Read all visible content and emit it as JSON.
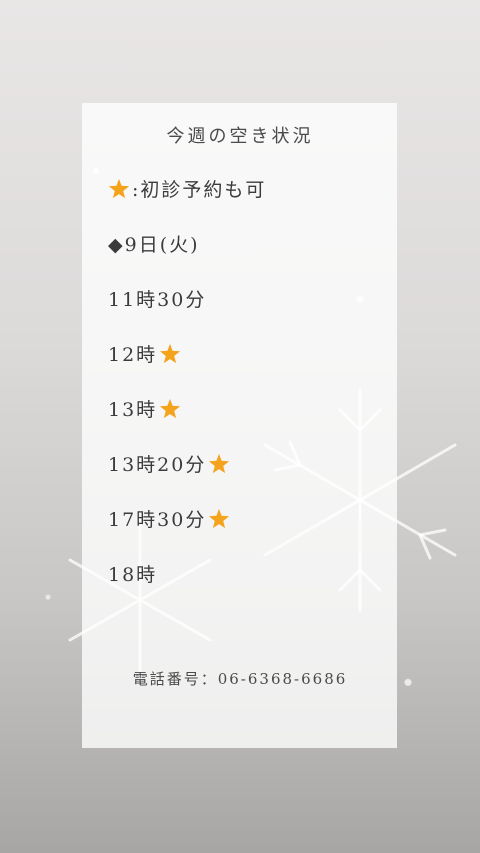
{
  "title": "今週の空き状況",
  "legend": ":初診予約も可",
  "date": "◆9日(火)",
  "slots": [
    {
      "time": "11時30分",
      "star": false
    },
    {
      "time": "12時",
      "star": true
    },
    {
      "time": "13時",
      "star": true
    },
    {
      "time": "13時20分",
      "star": true
    },
    {
      "time": "17時30分",
      "star": true
    },
    {
      "time": "18時",
      "star": false
    }
  ],
  "phone": "電話番号：06-6368-6686",
  "colors": {
    "star": "#f3a31c",
    "card": "#ffffff"
  },
  "icons": {
    "star": "star-icon",
    "background": "snowflake-glitter-background"
  }
}
